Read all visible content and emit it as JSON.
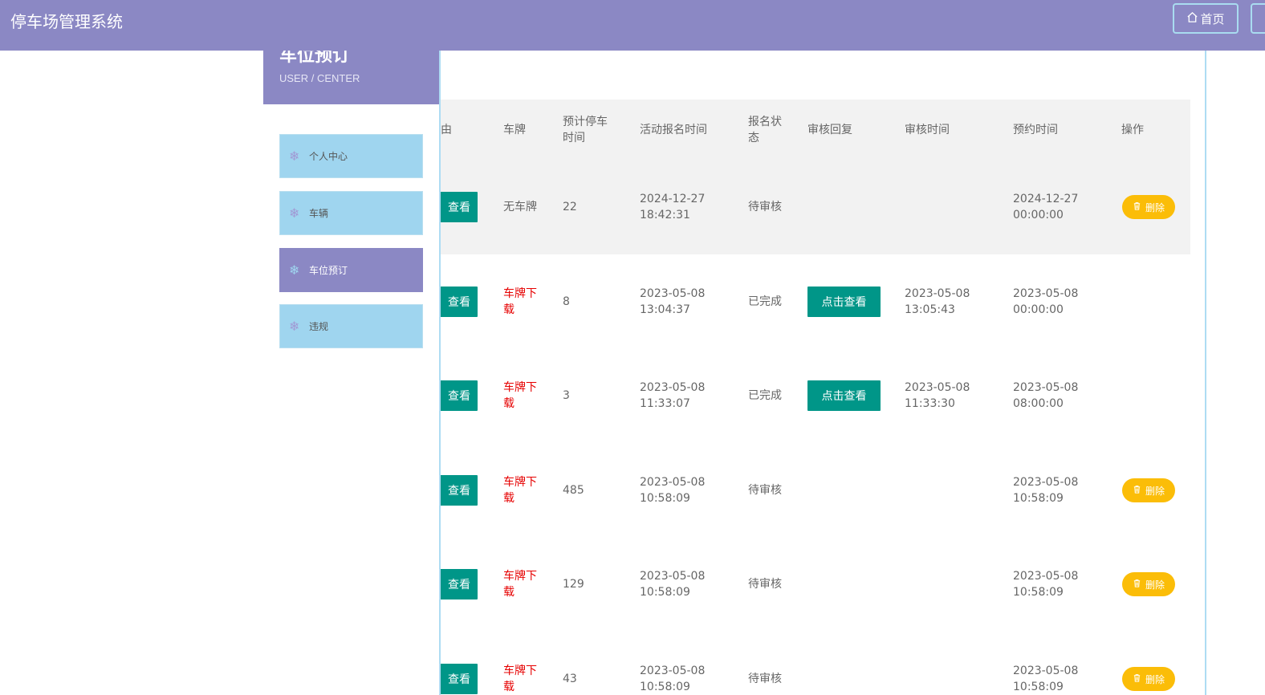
{
  "header": {
    "app_title": "停车场管理系统",
    "home_label": "首页"
  },
  "sidebar": {
    "title": "车位预订",
    "subtitle": "USER / CENTER",
    "items": [
      {
        "label": "个人中心",
        "active": false,
        "icon": "snowflake-icon"
      },
      {
        "label": "车辆",
        "active": false,
        "icon": "snowflake-icon"
      },
      {
        "label": "车位预订",
        "active": true,
        "icon": "snowflake-icon"
      },
      {
        "label": "违规",
        "active": false,
        "icon": "snowflake-icon"
      }
    ]
  },
  "table": {
    "columns": [
      "由",
      "车牌",
      "预计停车时间",
      "活动报名时间",
      "报名状态",
      "审核回复",
      "审核时间",
      "预约时间",
      "操作"
    ],
    "rows": [
      {
        "reason_btn": "查看",
        "plate": "无车牌",
        "plate_is_link": false,
        "hours": "22",
        "signup_time": "2024-12-27 18:42:31",
        "status": "待审核",
        "reply_btn": "",
        "review_time": "",
        "reserve_time": "2024-12-27 00:00:00",
        "delete_label": "删除"
      },
      {
        "reason_btn": "查看",
        "plate": "车牌下载",
        "plate_is_link": true,
        "hours": "8",
        "signup_time": "2023-05-08 13:04:37",
        "status": "已完成",
        "reply_btn": "点击查看",
        "review_time": "2023-05-08 13:05:43",
        "reserve_time": "2023-05-08 00:00:00",
        "delete_label": ""
      },
      {
        "reason_btn": "查看",
        "plate": "车牌下载",
        "plate_is_link": true,
        "hours": "3",
        "signup_time": "2023-05-08 11:33:07",
        "status": "已完成",
        "reply_btn": "点击查看",
        "review_time": "2023-05-08 11:33:30",
        "reserve_time": "2023-05-08 08:00:00",
        "delete_label": ""
      },
      {
        "reason_btn": "查看",
        "plate": "车牌下载",
        "plate_is_link": true,
        "hours": "485",
        "signup_time": "2023-05-08 10:58:09",
        "status": "待审核",
        "reply_btn": "",
        "review_time": "",
        "reserve_time": "2023-05-08 10:58:09",
        "delete_label": "删除"
      },
      {
        "reason_btn": "查看",
        "plate": "车牌下载",
        "plate_is_link": true,
        "hours": "129",
        "signup_time": "2023-05-08 10:58:09",
        "status": "待审核",
        "reply_btn": "",
        "review_time": "",
        "reserve_time": "2023-05-08 10:58:09",
        "delete_label": "删除"
      },
      {
        "reason_btn": "查看",
        "plate": "车牌下载",
        "plate_is_link": true,
        "hours": "43",
        "signup_time": "2023-05-08 10:58:09",
        "status": "待审核",
        "reply_btn": "",
        "review_time": "",
        "reserve_time": "2023-05-08 10:58:09",
        "delete_label": "删除"
      }
    ]
  },
  "colors": {
    "header_bg": "#8b88c4",
    "menu_bg": "#9fd5ef",
    "teal_button": "#009688",
    "delete_button": "#fbbd08",
    "link_red": "#e60000"
  }
}
